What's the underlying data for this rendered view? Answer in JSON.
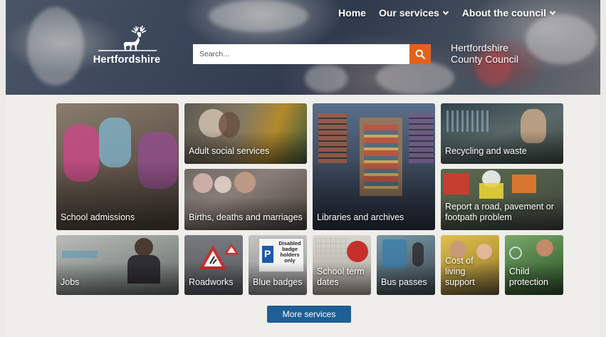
{
  "nav": {
    "home": "Home",
    "services": "Our services",
    "about": "About the council"
  },
  "logo": {
    "text": "Hertfordshire"
  },
  "search": {
    "placeholder": "Search..."
  },
  "council": {
    "line1": "Hertfordshire",
    "line2": "County Council"
  },
  "tiles": {
    "school": "School admissions",
    "adult": "Adult social services",
    "libraries": "Libraries and archives",
    "recycling": "Recycling and waste",
    "births": "Births, deaths and marriages",
    "report_line1": "Report a road, pavement or",
    "report_line2": "footpath problem",
    "jobs": "Jobs",
    "roadworks": "Roadworks",
    "blue": "Blue badges",
    "term_line1": "School term",
    "term_line2": "dates",
    "bus": "Bus passes",
    "cost_line1": "Cost of living",
    "cost_line2": "support",
    "child_line1": "Child",
    "child_line2": "protection",
    "badge_sign_1": "Disabled",
    "badge_sign_2": "badge",
    "badge_sign_3": "holders",
    "badge_sign_4": "only"
  },
  "more": {
    "label": "More services"
  },
  "colors": {
    "accent": "#e4611c",
    "button": "#1f5f95"
  }
}
